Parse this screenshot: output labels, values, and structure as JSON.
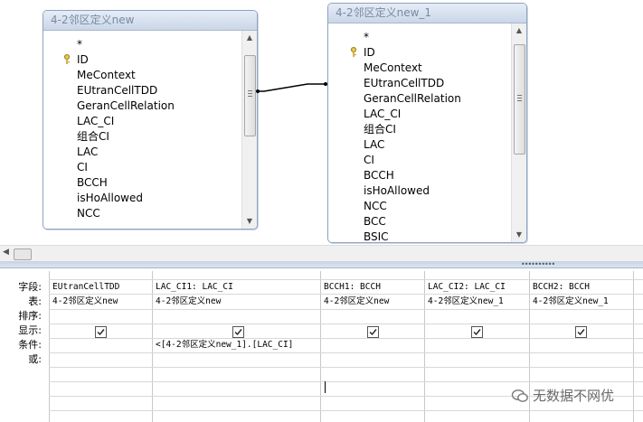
{
  "tables": [
    {
      "title": "4-2邻区定义new",
      "fields": [
        "*",
        "ID",
        "MeContext",
        "EUtranCellTDD",
        "GeranCellRelation",
        "LAC_CI",
        "组合CI",
        "LAC",
        "CI",
        "BCCH",
        "isHoAllowed",
        "NCC"
      ]
    },
    {
      "title": "4-2邻区定义new_1",
      "fields": [
        "*",
        "ID",
        "MeContext",
        "EUtranCellTDD",
        "GeranCellRelation",
        "LAC_CI",
        "组合CI",
        "LAC",
        "CI",
        "BCCH",
        "isHoAllowed",
        "NCC",
        "BCC",
        "BSIC"
      ]
    }
  ],
  "grid": {
    "row_labels": [
      "字段:",
      "表:",
      "排序:",
      "显示:",
      "条件:",
      "或:"
    ],
    "columns": [
      {
        "field": "EUtranCellTDD",
        "table": "4-2邻区定义new",
        "show": true,
        "criteria": ""
      },
      {
        "field": "LAC_CI1: LAC_CI",
        "table": "4-2邻区定义new",
        "show": true,
        "criteria": "<[4-2邻区定义new_1].[LAC_CI]"
      },
      {
        "field": "BCCH1: BCCH",
        "table": "4-2邻区定义new",
        "show": true,
        "criteria": ""
      },
      {
        "field": "LAC_CI2: LAC_CI",
        "table": "4-2邻区定义new_1",
        "show": true,
        "criteria": ""
      },
      {
        "field": "BCCH2: BCCH",
        "table": "4-2邻区定义new_1",
        "show": true,
        "criteria": ""
      }
    ]
  },
  "watermark": {
    "text": "无数据不网优"
  }
}
